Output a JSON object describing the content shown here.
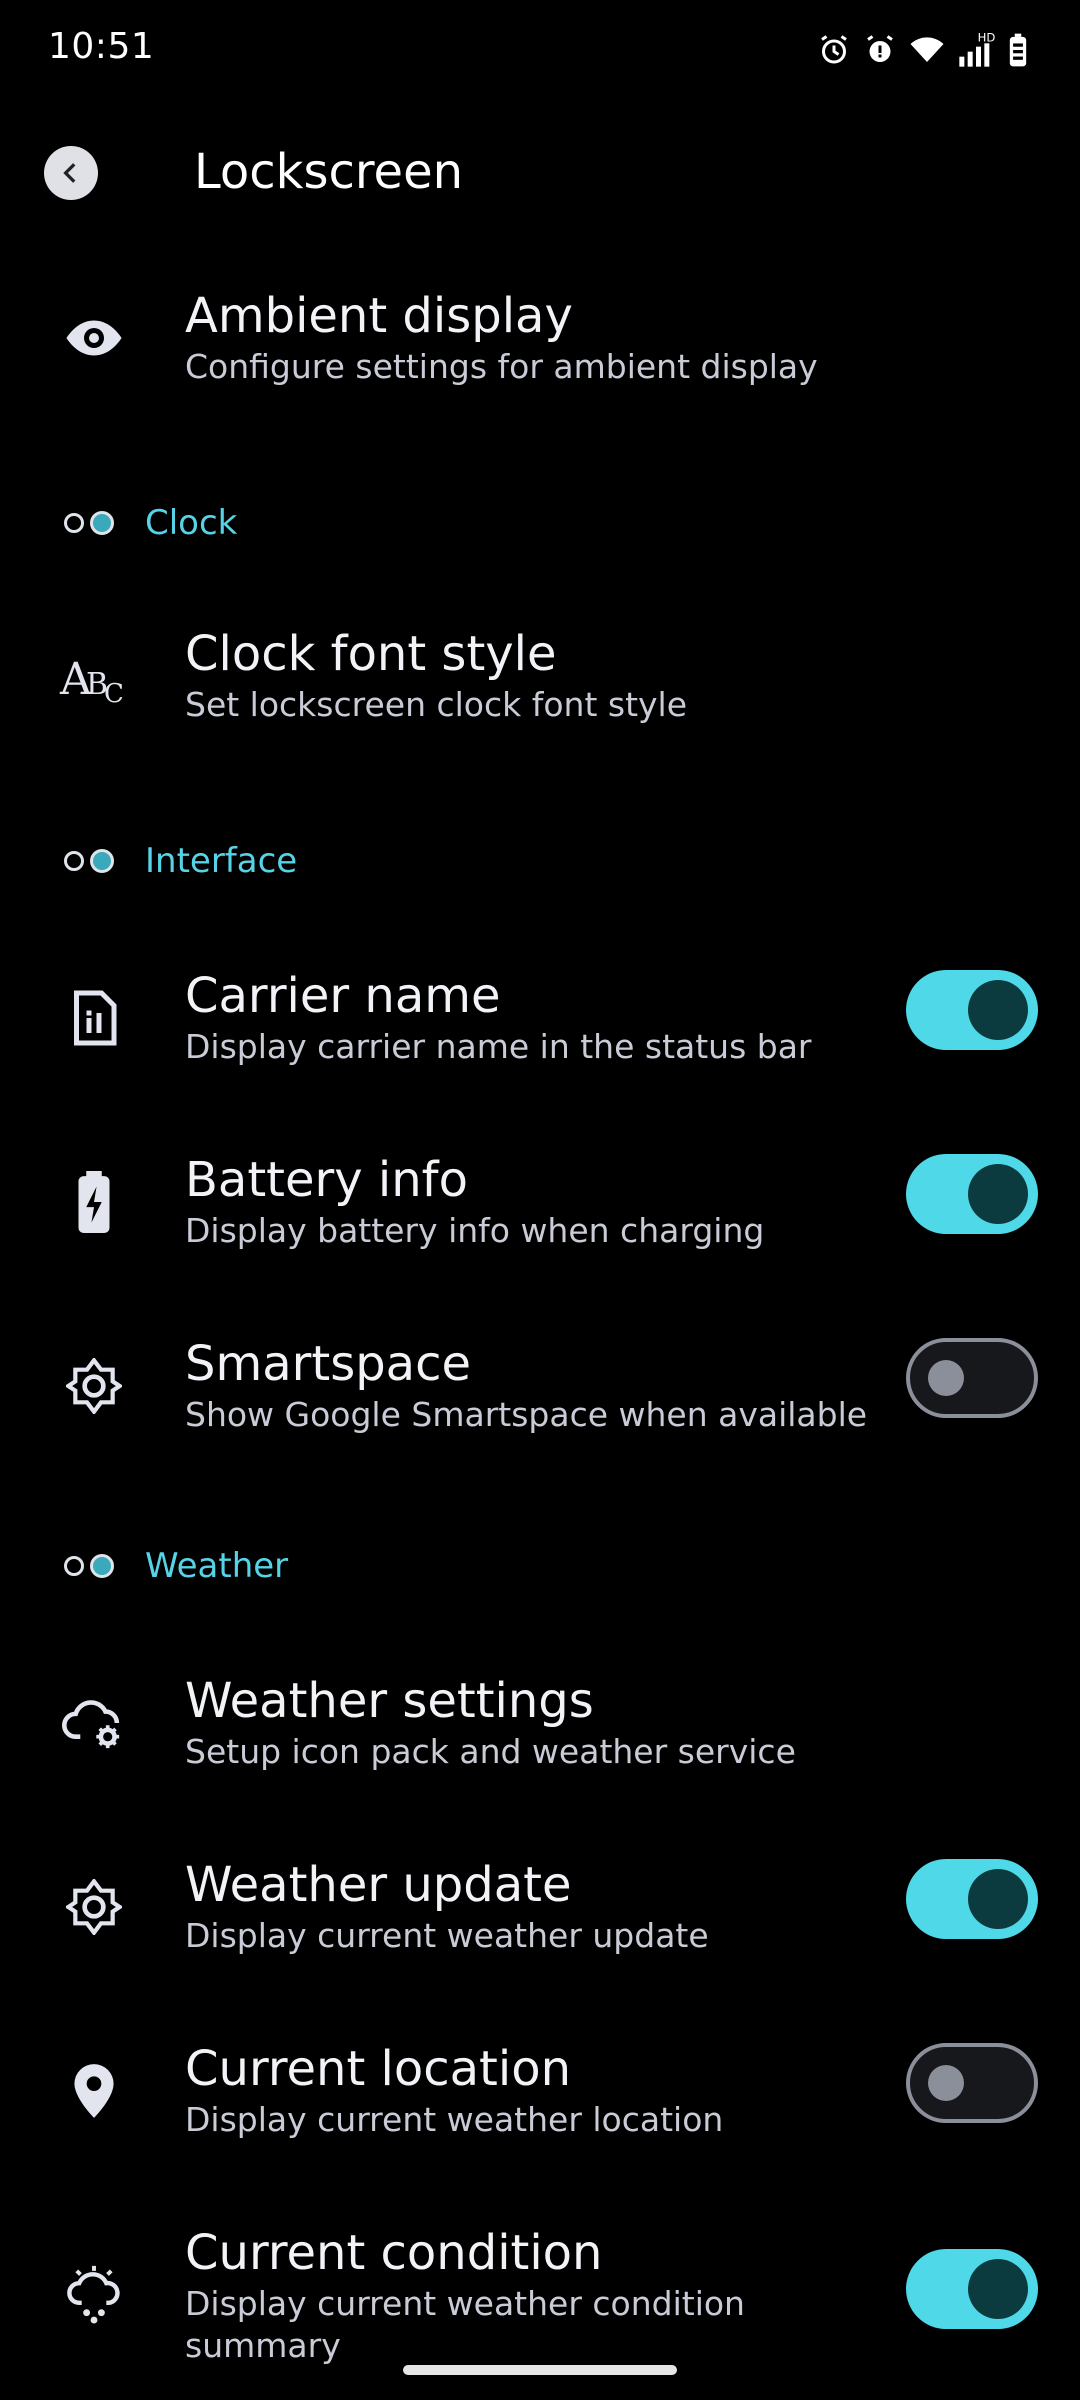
{
  "status_bar": {
    "time": "10:51",
    "icons": [
      "alarm-icon",
      "alert-alarm-icon",
      "wifi-icon",
      "signal-hd-icon",
      "battery-icon"
    ]
  },
  "header": {
    "title": "Lockscreen",
    "back_icon": "back-arrow-icon"
  },
  "ambient": {
    "title": "Ambient display",
    "subtitle": "Configure settings for ambient display",
    "icon": "eye-icon"
  },
  "sections": {
    "clock": "Clock",
    "interface": "Interface",
    "weather": "Weather"
  },
  "clock_font": {
    "title": "Clock font style",
    "subtitle": "Set lockscreen clock font style",
    "icon": "font-style-icon"
  },
  "carrier": {
    "title": "Carrier name",
    "subtitle": "Display carrier name in the status bar",
    "icon": "sim-card-icon",
    "enabled": true
  },
  "battery": {
    "title": "Battery info",
    "subtitle": "Display battery info when charging",
    "icon": "battery-charging-icon",
    "enabled": true
  },
  "smartspace": {
    "title": "Smartspace",
    "subtitle": "Show Google Smartspace when available",
    "icon": "brightness-icon",
    "enabled": false
  },
  "weather_settings": {
    "title": "Weather settings",
    "subtitle": "Setup icon pack and weather service",
    "icon": "cloud-gear-icon"
  },
  "weather_update": {
    "title": "Weather update",
    "subtitle": "Display current weather update",
    "icon": "brightness-icon",
    "enabled": true
  },
  "current_location": {
    "title": "Current location",
    "subtitle": "Display current weather location",
    "icon": "location-pin-icon",
    "enabled": false
  },
  "current_condition": {
    "title": "Current condition",
    "subtitle": "Display current weather condition summary",
    "icon": "weather-condition-icon",
    "enabled": true
  },
  "colors": {
    "accent": "#4fd8e8",
    "section_label": "#56d3e6",
    "background": "#000000"
  }
}
